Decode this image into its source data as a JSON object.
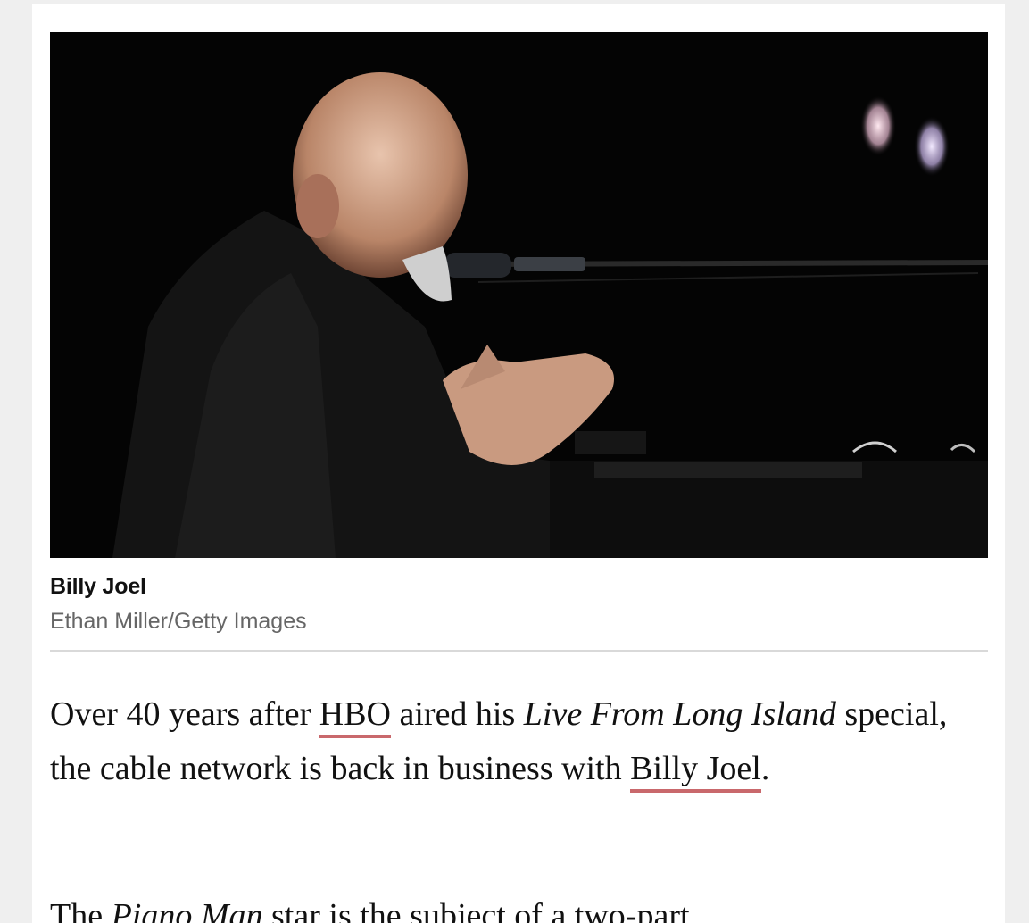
{
  "article": {
    "image": {
      "description_icon": "concert-photo-image"
    },
    "caption": {
      "title": "Billy Joel",
      "credit": "Ethan Miller/Getty Images"
    },
    "paragraph1": {
      "part1": "Over 40 years after ",
      "link1": "HBO",
      "part2": " aired his ",
      "italic1": "Live From Long Island",
      "part3": " special, the cable network is back in business with ",
      "link2": "Billy Joel",
      "part4": "."
    },
    "paragraph2": {
      "part1": "The ",
      "italic1": "Piano Man",
      "part2": " star is the subject of a two-part"
    },
    "colors": {
      "link_underline": "#c9686c",
      "caption_credit": "#666666"
    }
  }
}
